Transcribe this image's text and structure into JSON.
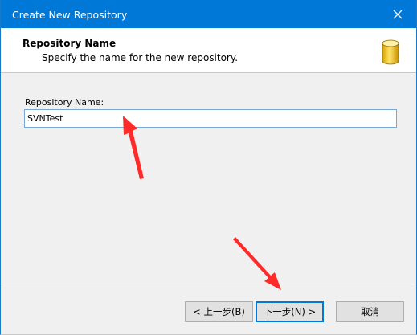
{
  "window": {
    "title": "Create New Repository"
  },
  "header": {
    "title": "Repository Name",
    "subtitle": "Specify the name for the new repository."
  },
  "form": {
    "label": "Repository Name:",
    "value": "SVNTest"
  },
  "buttons": {
    "back": "< 上一步(B)",
    "next": "下一步(N) >",
    "cancel": "取消"
  },
  "icons": {
    "close": "close-icon",
    "repository": "database-icon",
    "annotation": "arrow-annotation"
  },
  "colors": {
    "titlebar": "#0078d7",
    "annotation": "#ff2b2b"
  }
}
